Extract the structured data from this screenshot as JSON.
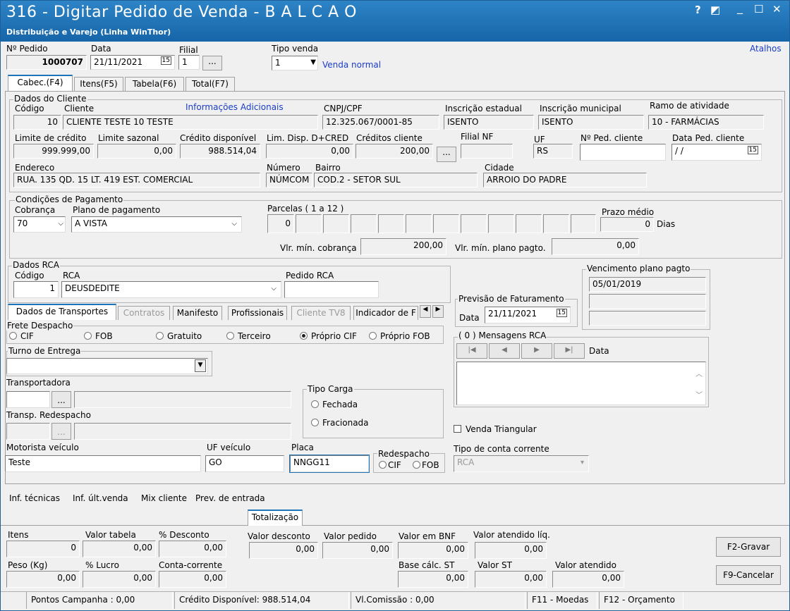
{
  "window": {
    "title": "316 - Digitar Pedido de Venda - B A L C A O",
    "subtitle": "Distribuição e Varejo (Linha WinThor)",
    "controls": [
      "?",
      "◩",
      "_",
      "☐",
      "✕"
    ],
    "atalhos": "Atalhos"
  },
  "header": {
    "pedido_label": "Nº Pedido",
    "pedido": "1000707",
    "data_label": "Data",
    "data": "21/11/2021",
    "filial_label": "Filial",
    "filial": "1",
    "tipo_venda_label": "Tipo venda",
    "tipo_venda": "1",
    "tipo_venda_desc": "Venda normal",
    "dots": "..."
  },
  "tabs": [
    "Cabec.(F4)",
    "Itens(F5)",
    "Tabela(F6)",
    "Total(F7)"
  ],
  "cliente": {
    "title": "Dados do Cliente",
    "codigo_label": "Código",
    "codigo": "10",
    "cliente_label": "Cliente",
    "info_link": "Informações Adicionais",
    "cliente": "CLIENTE TESTE 10 TESTE",
    "cnpj_label": "CNPJ/CPF",
    "cnpj": "12.325.067/0001-85",
    "ie_label": "Inscrição estadual",
    "ie": "ISENTO",
    "im_label": "Inscrição municipal",
    "im": "ISENTO",
    "ramo_label": "Ramo de atividade",
    "ramo": "10 - FARMÁCIAS",
    "limite_label": "Limite de crédito",
    "limite": "999.999,00",
    "sazonal_label": "Limite sazonal",
    "sazonal": "0,00",
    "disp_label": "Crédito disponível",
    "disp": "988.514,04",
    "lim_disp_label": "Lim. Disp. D+CRED",
    "lim_disp": "0,00",
    "creditos_label": "Créditos cliente",
    "creditos": "200,00",
    "filial_nf_label": "Filial NF",
    "uf_label": "UF",
    "uf": "RS",
    "nped_label": "Nº Ped. cliente",
    "data_ped_label": "Data Ped. cliente",
    "data_ped": "/ /",
    "endereco_label": "Endereco",
    "endereco": "RUA. 135 QD. 15 LT. 419 EST. COMERCIAL",
    "numero_label": "Número",
    "numero": "NÚMCOM",
    "bairro_label": "Bairro",
    "bairro": "COD.2 - SETOR SUL",
    "cidade_label": "Cidade",
    "cidade": "ARROIO DO PADRE"
  },
  "pagamento": {
    "title": "Condições de Pagamento",
    "cobranca_label": "Cobrança",
    "cobranca": "70",
    "plano_label": "Plano de pagamento",
    "plano": "A VISTA",
    "parcelas_label": "Parcelas ( 1 a 12 )",
    "parcela1": "0",
    "prazo_label": "Prazo médio",
    "prazo": "0",
    "dias": "Dias",
    "vmin_cob_label": "Vlr. mín. cobrança",
    "vmin_cob": "200,00",
    "vmin_plano_label": "Vlr. mín. plano pagto.",
    "vmin_plano": "0,00"
  },
  "rca": {
    "title": "Dados RCA",
    "codigo_label": "Código",
    "codigo": "1",
    "rca_label": "RCA",
    "rca": "DEUSDEDITE",
    "pedido_label": "Pedido RCA",
    "venc_title": "Vencimento plano pagto",
    "venc1": "05/01/2019"
  },
  "subtabs": [
    "Dados de Transportes",
    "Contratos",
    "Manifesto",
    "Profissionais",
    "Cliente TV8",
    "Indicador de F"
  ],
  "transporte": {
    "frete_title": "Frete Despacho",
    "frete": [
      "CIF",
      "FOB",
      "Gratuito",
      "Terceiro",
      "Próprio CIF",
      "Próprio FOB"
    ],
    "turno_title": "Turno de Entrega",
    "transp_label": "Transportadora",
    "redesp_label": "Transp. Redespacho",
    "tipo_carga_title": "Tipo Carga",
    "fechada": "Fechada",
    "fracionada": "Fracionada",
    "motorista_label": "Motorista veículo",
    "motorista": "Teste",
    "ufv_label": "UF veículo",
    "ufv": "GO",
    "placa_label": "Placa",
    "placa": "NNGG11",
    "redespacho_title": "Redespacho",
    "r_cif": "CIF",
    "r_fob": "FOB"
  },
  "previsao": {
    "title": "Previsão de Faturamento",
    "data_label": "Data",
    "data": "21/11/2021"
  },
  "mensagens": {
    "title": "( 0 ) Mensagens RCA",
    "data_label": "Data"
  },
  "venda_triangular": "Venda Triangular",
  "tipo_conta_label": "Tipo de conta corrente",
  "tipo_conta": "RCA",
  "links": [
    "Inf. técnicas",
    "Inf. últ.venda",
    "Mix cliente",
    "Prev. de entrada"
  ],
  "totalizacao": {
    "tab": "Totalização",
    "itens_label": "Itens",
    "itens": "0",
    "vtab_label": "Valor tabela",
    "vtab": "0,00",
    "desc_label": "% Desconto",
    "desc": "0,00",
    "vdesc_label": "Valor desconto",
    "vdesc": "0,00",
    "vped_label": "Valor pedido",
    "vped": "0,00",
    "bnf_label": "Valor em BNF",
    "bnf": "0,00",
    "vat_liq_label": "Valor atendido líq.",
    "vat_liq": "0,00",
    "peso_label": "Peso (Kg)",
    "peso": "0,00",
    "lucro_label": "% Lucro",
    "lucro": "0,00",
    "cc_label": "Conta-corrente",
    "cc": "0,00",
    "base_st_label": "Base cálc. ST",
    "base_st": "0,00",
    "vst_label": "Valor ST",
    "vst": "0,00",
    "vat_label": "Valor atendido",
    "vat": "0,00"
  },
  "buttons": {
    "gravar": "F2-Gravar",
    "cancelar": "F9-Cancelar"
  },
  "status": {
    "pontos": "Pontos Campanha : 0,00",
    "credito": "Crédito Disponível: 988.514,04",
    "comissao": "Vl.Comissão : 0,00",
    "moedas": "F11 - Moedas",
    "orcamento": "F12 - Orçamento"
  }
}
